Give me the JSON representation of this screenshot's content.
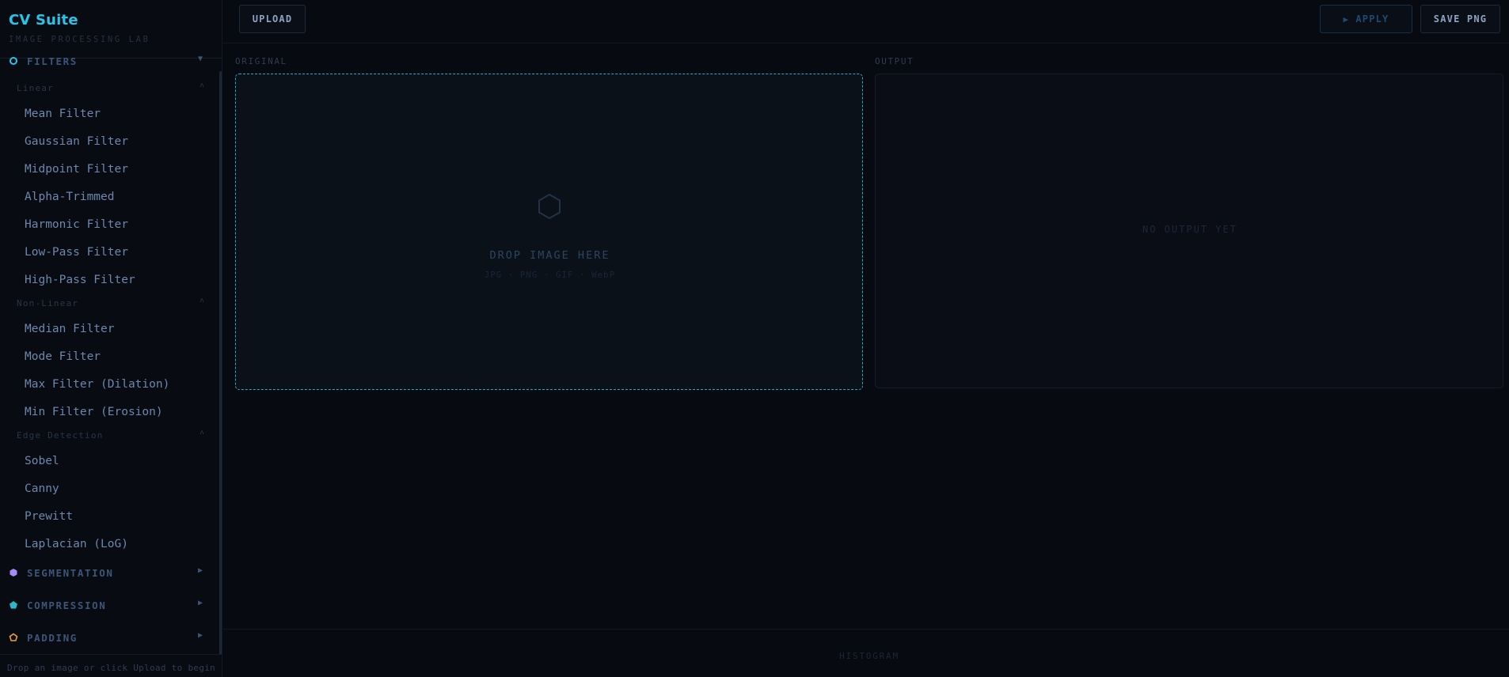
{
  "brand": {
    "title": "CV Suite",
    "subtitle": "IMAGE PROCESSING LAB"
  },
  "sidebar": {
    "filters": {
      "label": "FILTERS",
      "arrow": "▼",
      "icon": "ring-icon",
      "icon_color": "#26c6ea",
      "groups": [
        {
          "label": "Linear",
          "caret": "˄",
          "items": [
            "Mean Filter",
            "Gaussian Filter",
            "Midpoint Filter",
            "Alpha-Trimmed",
            "Harmonic Filter",
            "Low-Pass Filter",
            "High-Pass Filter"
          ]
        },
        {
          "label": "Non-Linear",
          "caret": "˄",
          "items": [
            "Median Filter",
            "Mode Filter",
            "Max Filter (Dilation)",
            "Min Filter (Erosion)"
          ]
        },
        {
          "label": "Edge Detection",
          "caret": "˄",
          "items": [
            "Sobel",
            "Canny",
            "Prewitt",
            "Laplacian (LoG)"
          ]
        }
      ]
    },
    "segmentation": {
      "label": "SEGMENTATION",
      "arrow": "▶",
      "icon": "hexagon-icon",
      "icon_color": "#a78bfa"
    },
    "compression": {
      "label": "COMPRESSION",
      "arrow": "▶",
      "icon": "pentagon-icon",
      "icon_color": "#2bb7c9"
    },
    "padding": {
      "label": "PADDING",
      "arrow": "▶",
      "icon": "pentagon-outline-icon",
      "icon_color": "#f0a030"
    },
    "footer": "Drop an image or click Upload to begin"
  },
  "toolbar": {
    "upload_label": "UPLOAD",
    "apply_icon": "▶",
    "apply_label": "APPLY",
    "save_label": "SAVE PNG"
  },
  "panes": {
    "original_label": "ORIGINAL",
    "output_label": "OUTPUT",
    "drop_title": "DROP IMAGE HERE",
    "drop_formats": "JPG · PNG · GIF · WebP",
    "no_output": "NO OUTPUT YET",
    "dropzone_border_color": "#22aac9"
  },
  "histogram": {
    "label": "HISTOGRAM"
  }
}
